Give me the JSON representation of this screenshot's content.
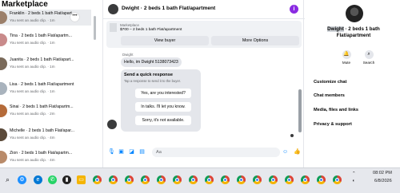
{
  "left_panel": {
    "title": "Marketplace",
    "conversations": [
      {
        "name": "Franklin · 2 beds 1 bath Flat/apart...",
        "sub": "You sent an audio clip. · 1m",
        "color": "#9b7f6a",
        "active": true
      },
      {
        "name": "Tina · 2 beds 1 bath Flat/apartm...",
        "sub": "You sent an audio clip. · 1m",
        "color": "#c98b8b"
      },
      {
        "name": "Juanita · 2 beds 1 bath Flat/apart...",
        "sub": "You sent an audio clip. · 1m",
        "color": "#7a6a5a"
      },
      {
        "name": "Lisa · 2 beds 1 bath Flat/apartment",
        "sub": "You sent an audio clip. · 1m",
        "color": "#a9b3bd"
      },
      {
        "name": "Sinai · 2 beds 1 bath Flat/apartm...",
        "sub": "You sent an audio clip. · 2m",
        "color": "#b56b3a"
      },
      {
        "name": "Michelle · 2 beds 1 bath Flat/apar...",
        "sub": "You sent an audio clip. · 4m",
        "color": "#5b4a3a"
      },
      {
        "name": "Zion · 2 beds 1 bath Flat/apartm...",
        "sub": "You sent an audio clip. · 4m",
        "color": "#b98b6a"
      }
    ]
  },
  "chat": {
    "title": "Dwight · 2 beds 1 bath Flat/apartment",
    "marketplace_label": "Marketplace",
    "listing": "$700 – 2 beds 1 bath Flat/apartment",
    "view_buyer": "View buyer",
    "more_options": "More Options",
    "sender_name": "Dwight",
    "message": "Hello, im Dwight 5138073423",
    "quick_title": "Send a quick response",
    "quick_sub": "Tap a response to send it to the buyer.",
    "quick_options": [
      "Yes, are you interested?",
      "In talks. I'll let you know.",
      "Sorry, it's not available."
    ],
    "input_placeholder": "Aa"
  },
  "right_panel": {
    "name_highlight": "Dwight",
    "name_rest": " · 2 beds 1 bath",
    "name_line2": "Flat/apartment",
    "mute": "Mute",
    "search": "Search",
    "links": [
      "Customize chat",
      "Chat members",
      "Media, files and links",
      "Privacy & support"
    ]
  },
  "taskbar": {
    "time": "08:02 PM",
    "date": "6/8/2026"
  },
  "colors": {
    "accent": "#0084ff",
    "info": "#8a2be2"
  }
}
